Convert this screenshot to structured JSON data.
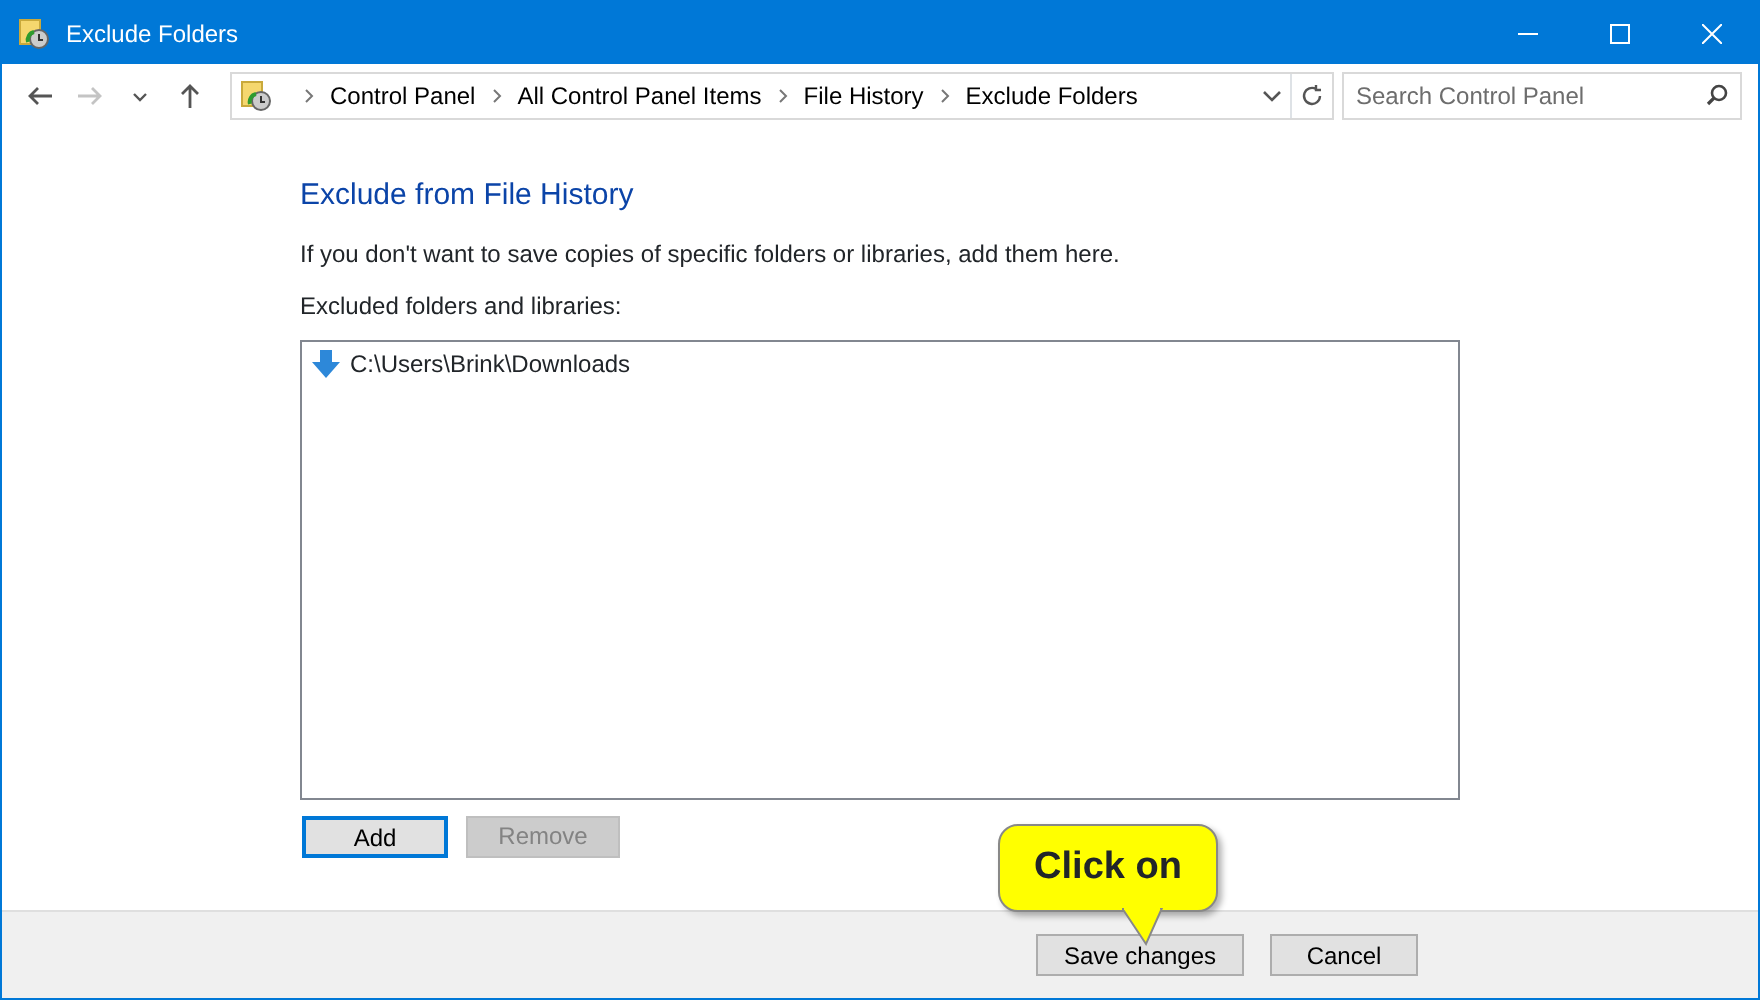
{
  "window": {
    "title": "Exclude Folders"
  },
  "navigation": {
    "buttons": [
      {
        "kind": "back",
        "disabled": false
      },
      {
        "kind": "forward",
        "disabled": true
      },
      {
        "kind": "recent",
        "disabled": false
      },
      {
        "kind": "up",
        "disabled": false
      }
    ],
    "breadcrumb": [
      "Control Panel",
      "All Control Panel Items",
      "File History",
      "Exclude Folders"
    ],
    "search": {
      "placeholder": "Search Control Panel"
    }
  },
  "content": {
    "heading": "Exclude from File History",
    "description": "If you don't want to save copies of specific folders or libraries, add them here.",
    "list_label": "Excluded folders and libraries:",
    "items": [
      {
        "path": "C:\\Users\\Brink\\Downloads",
        "selected": false
      }
    ],
    "buttons": [
      {
        "label": "Add",
        "disabled": false,
        "focused": true
      },
      {
        "label": "Remove",
        "disabled": true,
        "focused": false
      }
    ]
  },
  "footer": {
    "buttons": [
      {
        "label": "Save changes"
      },
      {
        "label": "Cancel"
      }
    ]
  },
  "callout": {
    "text": "Click on"
  }
}
